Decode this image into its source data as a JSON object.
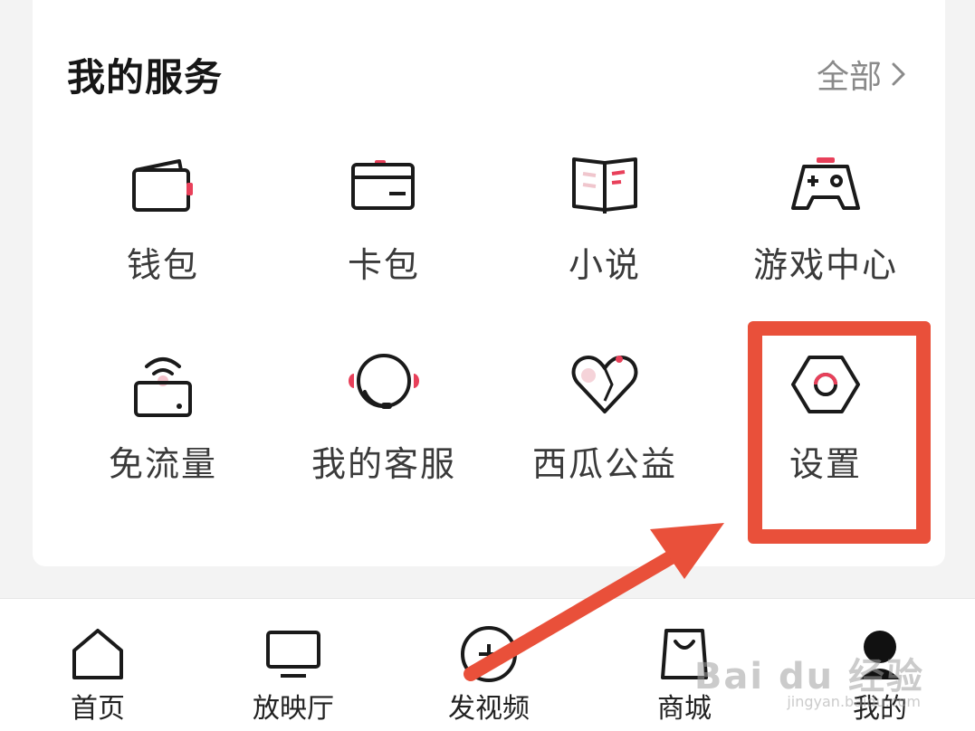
{
  "services": {
    "title": "我的服务",
    "see_all": "全部",
    "items": [
      {
        "label": "钱包",
        "icon": "wallet-icon"
      },
      {
        "label": "卡包",
        "icon": "card-icon"
      },
      {
        "label": "小说",
        "icon": "book-icon"
      },
      {
        "label": "游戏中心",
        "icon": "gamepad-icon"
      },
      {
        "label": "免流量",
        "icon": "router-icon"
      },
      {
        "label": "我的客服",
        "icon": "headset-icon"
      },
      {
        "label": "西瓜公益",
        "icon": "heart-icon"
      },
      {
        "label": "设置",
        "icon": "settings-hex-icon"
      }
    ]
  },
  "tabbar": {
    "items": [
      {
        "label": "首页",
        "icon": "home-icon"
      },
      {
        "label": "放映厅",
        "icon": "tv-icon"
      },
      {
        "label": "发视频",
        "icon": "plus-circle-icon"
      },
      {
        "label": "商城",
        "icon": "shopping-bag-icon"
      },
      {
        "label": "我的",
        "icon": "profile-icon"
      }
    ]
  },
  "watermark": {
    "text": "Bai du 经验",
    "sub": "jingyan.baidu.com"
  },
  "colors": {
    "accent": "#e8405a",
    "annotation": "#e9503a",
    "text": "#222222"
  }
}
